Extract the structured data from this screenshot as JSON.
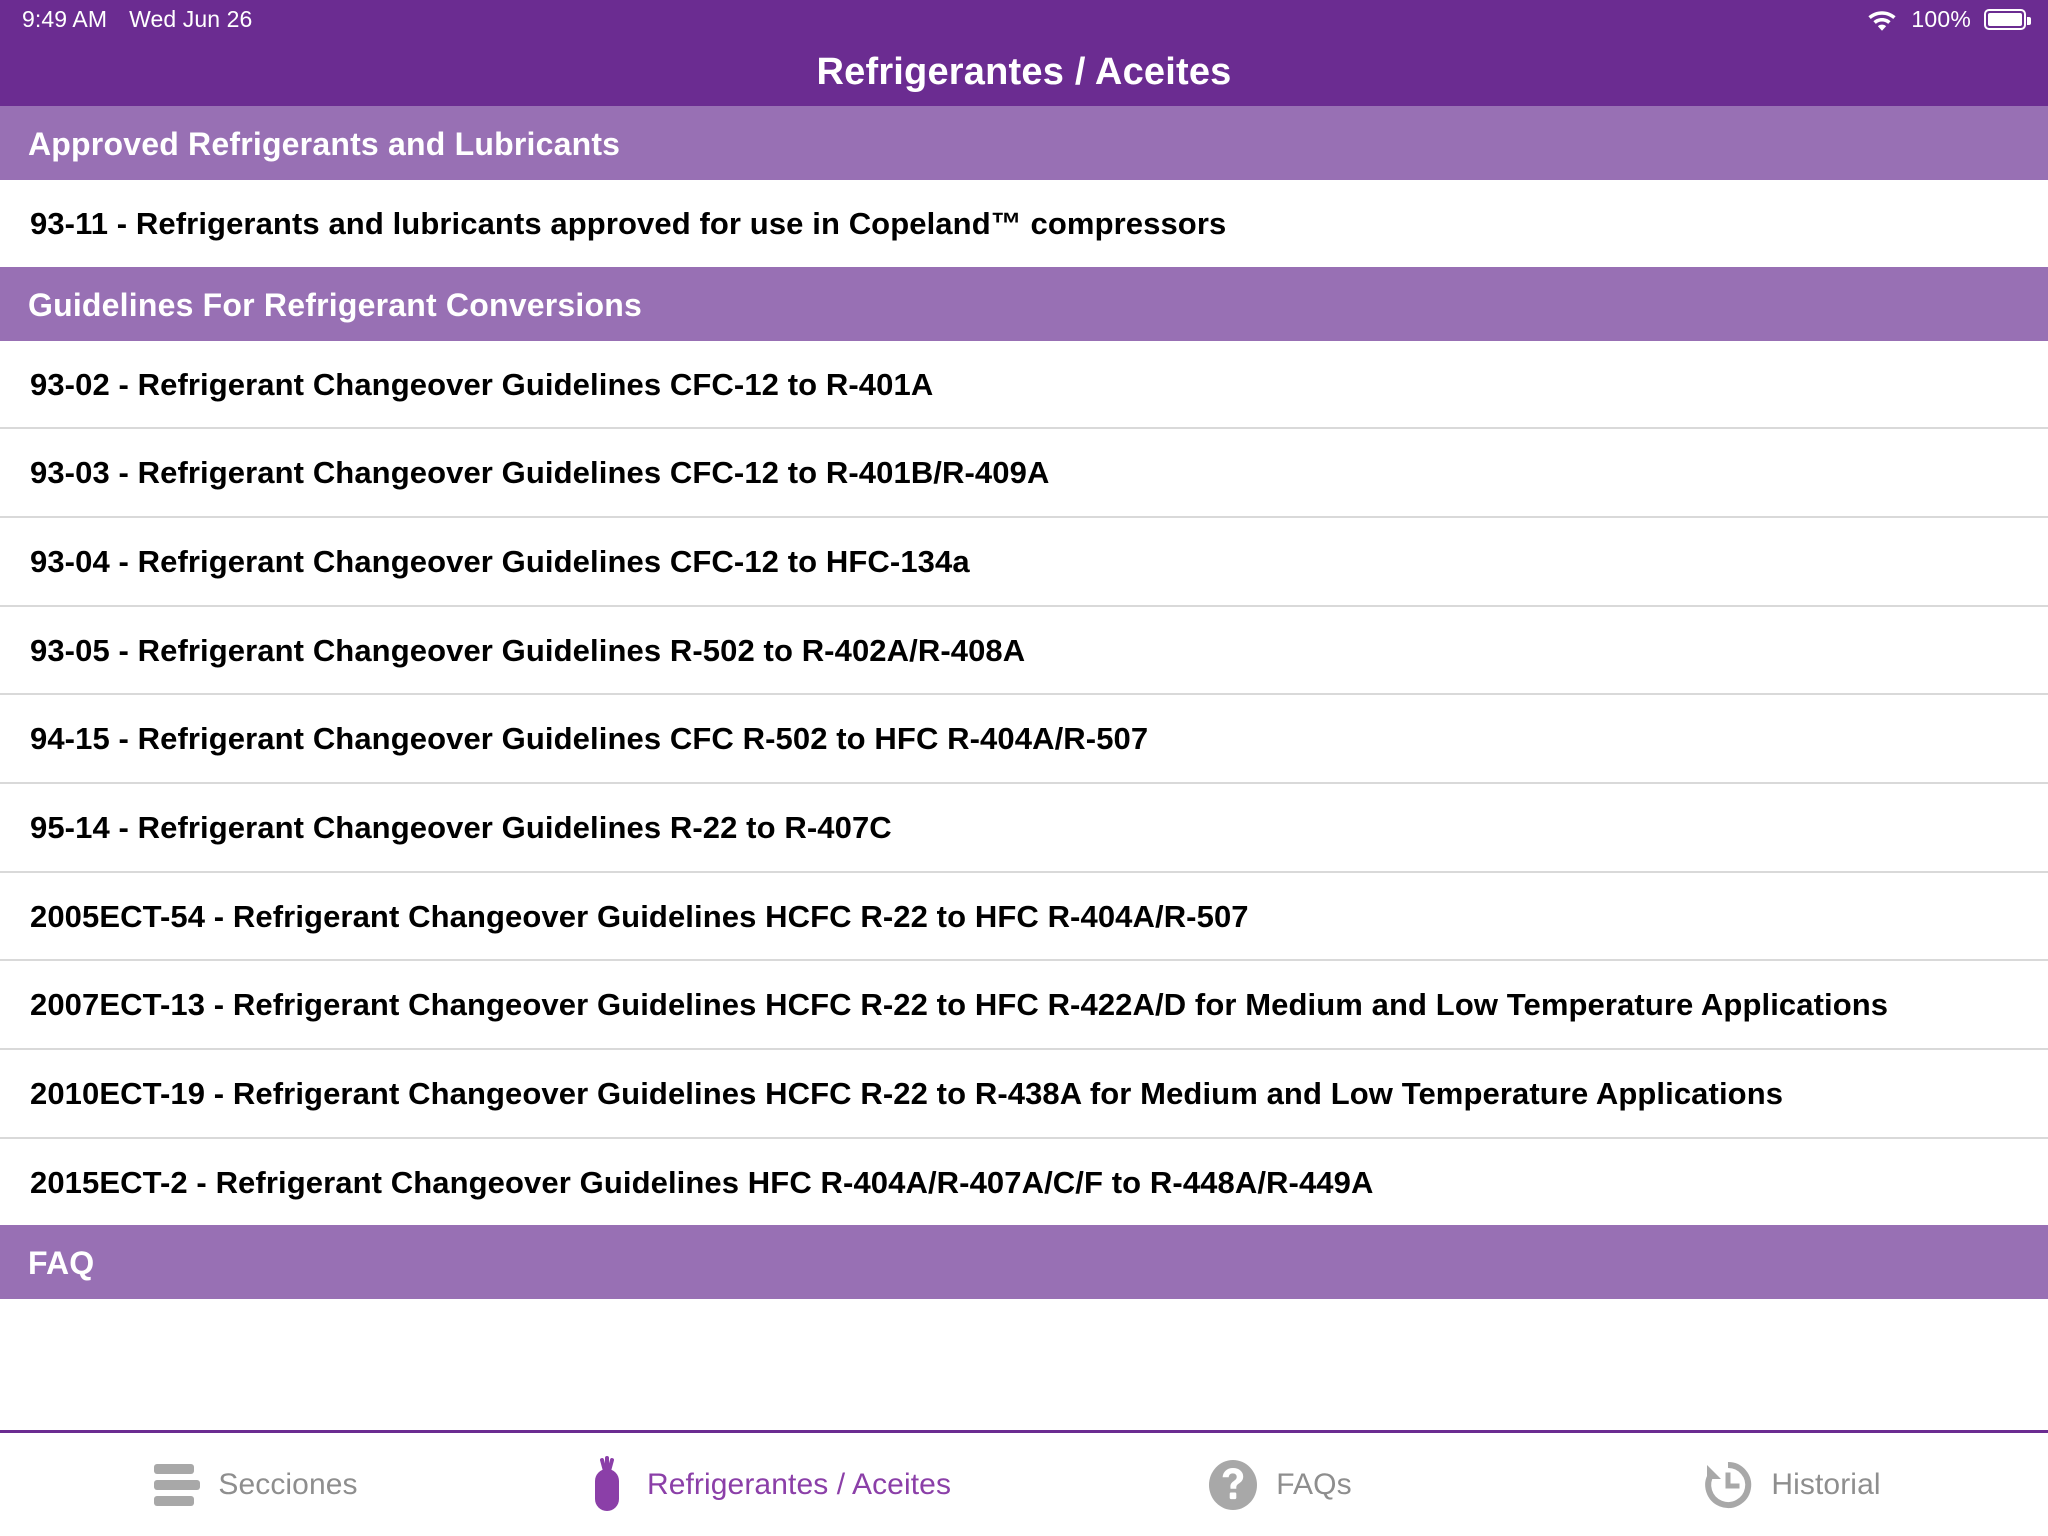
{
  "status_bar": {
    "time": "9:49 AM",
    "date": "Wed Jun 26",
    "wifi_icon": "wifi-icon",
    "battery_percent": "100%",
    "battery_icon": "battery-full-icon"
  },
  "navbar": {
    "title": "Refrigerantes / Aceites",
    "background_color": "#6B2C91"
  },
  "theme": {
    "nav_purple": "#6B2C91",
    "section_purple": "#9870B4",
    "active_tab_purple": "#8B3FA8",
    "inactive_tab_gray": "#8e8e8e",
    "row_divider": "#d9d9d9"
  },
  "sections": [
    {
      "header": "Approved Refrigerants and Lubricants",
      "rows": [
        "93-11 - Refrigerants and lubricants approved for use in Copeland™ compressors"
      ]
    },
    {
      "header": "Guidelines For Refrigerant Conversions",
      "rows": [
        "93-02 - Refrigerant Changeover Guidelines CFC-12 to R-401A",
        "93-03 - Refrigerant Changeover Guidelines CFC-12 to R-401B/R-409A",
        "93-04 - Refrigerant Changeover Guidelines CFC-12 to HFC-134a",
        "93-05 - Refrigerant Changeover Guidelines R-502 to R-402A/R-408A",
        "94-15 - Refrigerant Changeover Guidelines CFC R-502 to HFC R-404A/R-507",
        "95-14 - Refrigerant Changeover Guidelines R-22 to R-407C",
        "2005ECT-54 - Refrigerant Changeover Guidelines HCFC R-22 to HFC R-404A/R-507",
        "2007ECT-13 - Refrigerant Changeover Guidelines HCFC R-22 to HFC R-422A/D for Medium and Low Temperature Applications",
        "2010ECT-19 - Refrigerant Changeover Guidelines HCFC R-22 to R-438A for Medium and Low Temperature Applications",
        "2015ECT-2 - Refrigerant Changeover Guidelines HFC R-404A/R-407A/C/F to R-448A/R-449A"
      ]
    },
    {
      "header": "FAQ",
      "rows": []
    }
  ],
  "tabbar": {
    "tabs": [
      {
        "label": "Secciones",
        "icon": "hamburger-menu-icon",
        "active": false
      },
      {
        "label": "Refrigerantes / Aceites",
        "icon": "refrigerant-cylinder-icon",
        "active": true
      },
      {
        "label": "FAQs",
        "icon": "question-mark-circle-icon",
        "active": false
      },
      {
        "label": "Historial",
        "icon": "history-rewind-icon",
        "active": false
      }
    ]
  }
}
